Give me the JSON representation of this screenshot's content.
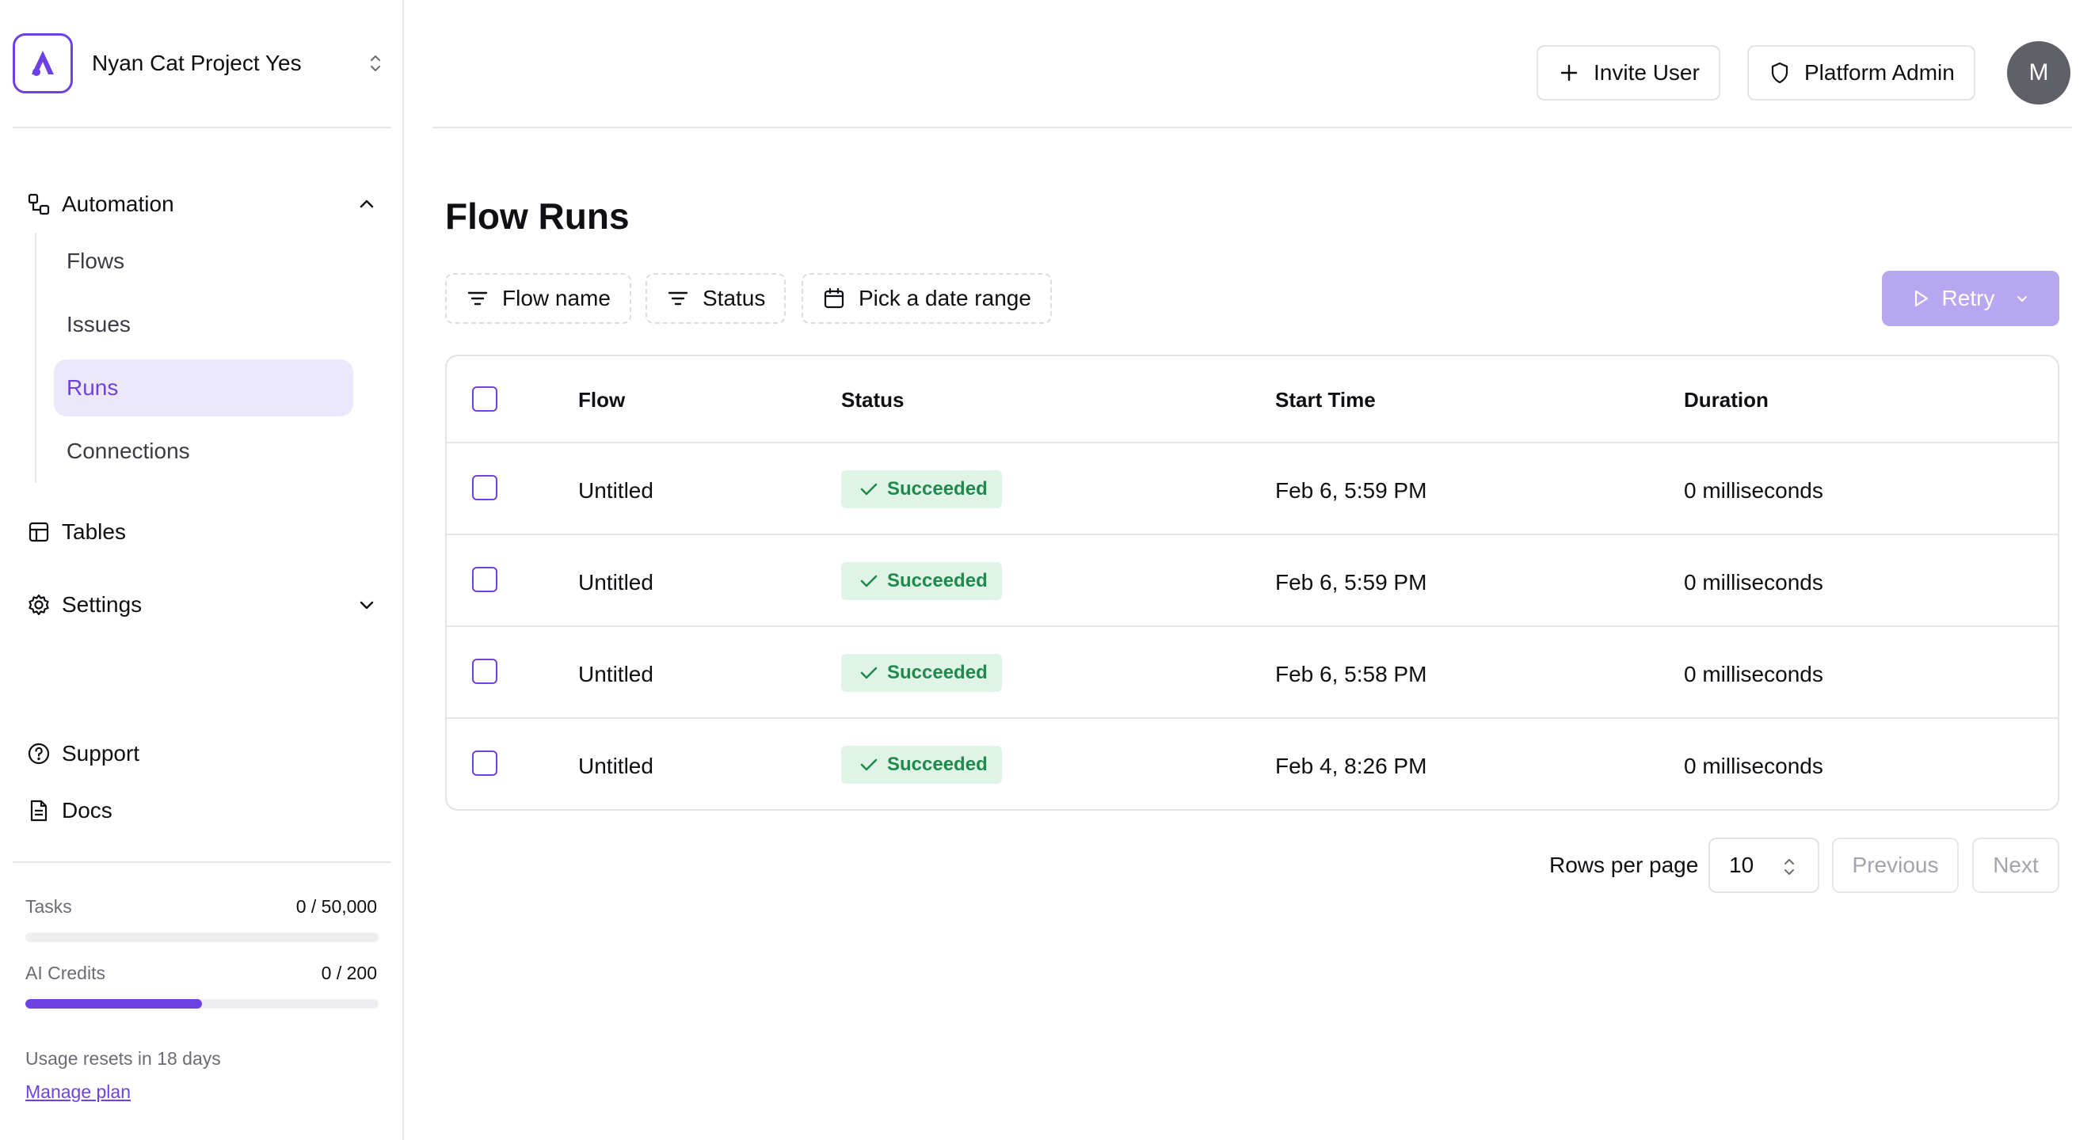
{
  "sidebar": {
    "project_name": "Nyan Cat Project Yes",
    "automation": {
      "label": "Automation",
      "items": [
        "Flows",
        "Issues",
        "Runs",
        "Connections"
      ],
      "active": "Runs"
    },
    "tables_label": "Tables",
    "settings_label": "Settings",
    "support_label": "Support",
    "docs_label": "Docs",
    "usage": {
      "tasks": {
        "label": "Tasks",
        "value": "0 / 50,000",
        "fraction": 0.0
      },
      "ai_credits": {
        "label": "AI Credits",
        "value": "0 / 200",
        "fraction": 0.5
      },
      "reset_text": "Usage resets in 18 days",
      "manage_plan": "Manage plan"
    }
  },
  "header": {
    "invite_user": "Invite User",
    "platform_admin": "Platform Admin",
    "avatar_initial": "M"
  },
  "main": {
    "title": "Flow Runs",
    "filters": {
      "flow_name": "Flow name",
      "status": "Status",
      "date_range": "Pick a date range"
    },
    "retry_label": "Retry",
    "table": {
      "columns": [
        "Flow",
        "Status",
        "Start Time",
        "Duration"
      ],
      "rows": [
        {
          "flow": "Untitled",
          "status": "Succeeded",
          "start": "Feb 6, 5:59 PM",
          "duration": "0 milliseconds"
        },
        {
          "flow": "Untitled",
          "status": "Succeeded",
          "start": "Feb 6, 5:59 PM",
          "duration": "0 milliseconds"
        },
        {
          "flow": "Untitled",
          "status": "Succeeded",
          "start": "Feb 6, 5:58 PM",
          "duration": "0 milliseconds"
        },
        {
          "flow": "Untitled",
          "status": "Succeeded",
          "start": "Feb 4, 8:26 PM",
          "duration": "0 milliseconds"
        }
      ]
    },
    "pagination": {
      "rows_per_page_label": "Rows per page",
      "rows_per_page_value": "10",
      "previous": "Previous",
      "next": "Next"
    }
  },
  "colors": {
    "accent": "#6e41e2",
    "accent_soft": "#ece8fb",
    "success_bg": "#dff3e7",
    "success_text": "#1f8a4c",
    "retry_disabled": "#b7a6f0"
  },
  "icons": {
    "logo": "brand-logo-icon",
    "project_switch": "chevrons-up-down-icon",
    "automation": "workflow-icon",
    "tables": "table-icon",
    "settings": "gear-icon",
    "support": "help-circle-icon",
    "docs": "file-text-icon",
    "invite": "plus-icon",
    "platform_admin": "shield-icon",
    "filter": "filter-lines-icon",
    "calendar": "calendar-icon",
    "retry": "play-icon",
    "success": "check-icon"
  }
}
